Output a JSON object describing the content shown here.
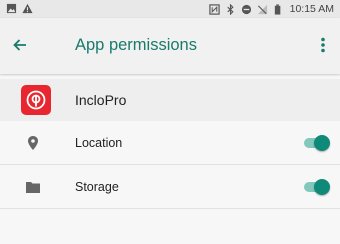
{
  "status_bar": {
    "time": "10:15 AM",
    "left_icons": [
      "image-icon",
      "warning-icon"
    ],
    "right_icons": [
      "nfc-icon",
      "bluetooth-icon",
      "do-not-disturb-icon",
      "no-signal-icon",
      "battery-icon"
    ]
  },
  "toolbar": {
    "title": "App permissions",
    "back_icon": "arrow-back-icon",
    "menu_icon": "more-vert-icon"
  },
  "app": {
    "name": "IncloPro",
    "logo_color": "#e8262f"
  },
  "permissions": [
    {
      "label": "Location",
      "icon": "location-pin-icon",
      "enabled": true
    },
    {
      "label": "Storage",
      "icon": "folder-icon",
      "enabled": true
    }
  ],
  "colors": {
    "accent": "#1a7a6c",
    "toggle_thumb": "#0f8a78",
    "toggle_track": "#82c8bd"
  }
}
